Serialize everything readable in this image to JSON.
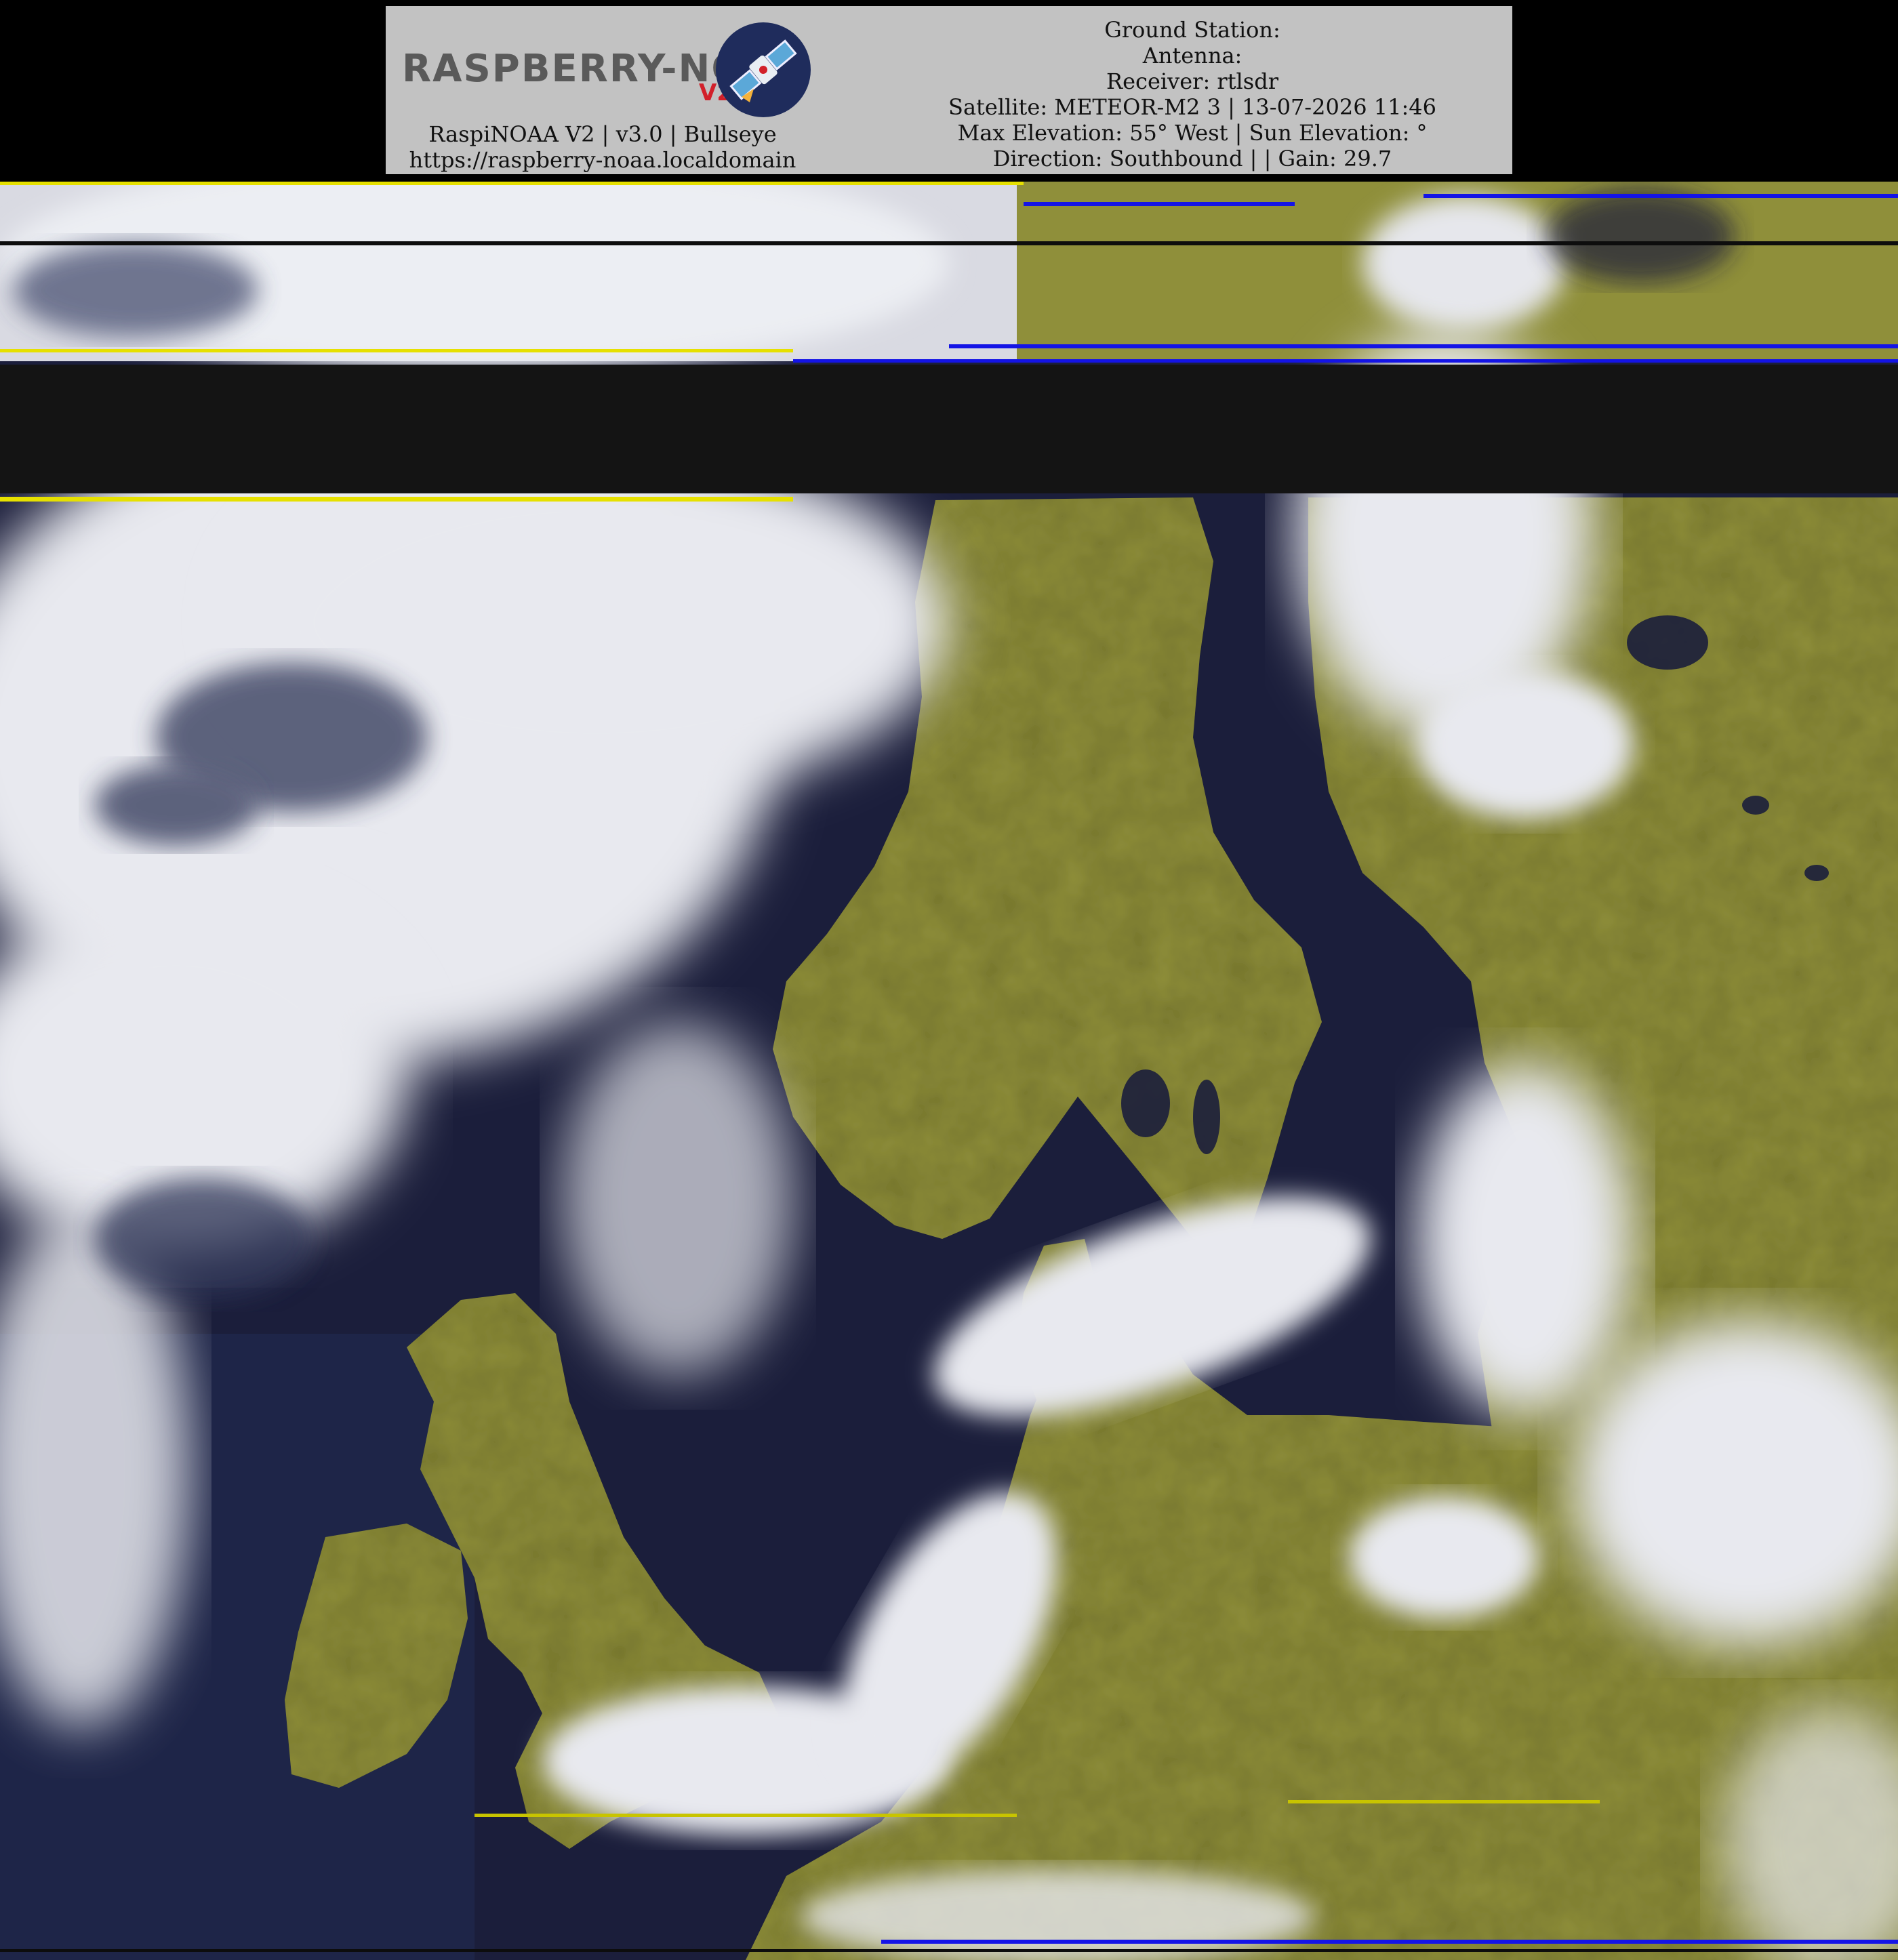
{
  "banner": {
    "logo_text": "RASPBERRY-NOAA",
    "logo_badge": "V2",
    "left_lines": [
      "RaspiNOAA V2 | v3.0 | Bullseye",
      "https://raspberry-noaa.localdomain"
    ],
    "right_lines": [
      "Ground Station:",
      "Antenna:",
      "Receiver: rtlsdr",
      "Satellite: METEOR-M2 3 | 13-07-2026 11:46",
      "Max Elevation: 55° West | Sun Elevation: °",
      "Direction: Southbound | | Gain: 29.7"
    ]
  },
  "imagery": {
    "colors": {
      "sea": "#1b1e3b",
      "land": "#8f8f3a",
      "cloud": "#e8e9ef",
      "gap": "#141414",
      "noise_yellow": "#e6e000",
      "noise_blue": "#1414e6"
    }
  }
}
